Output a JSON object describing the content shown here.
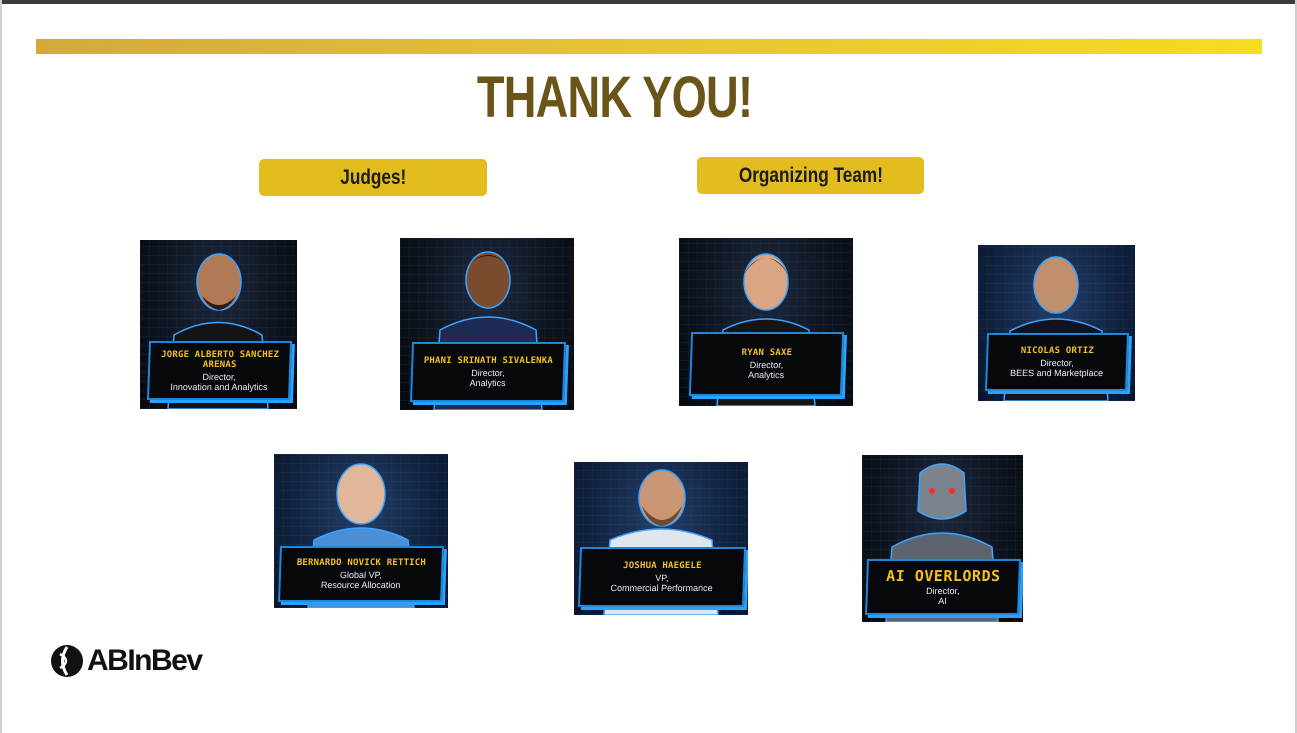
{
  "title": "THANK YOU!",
  "groups": {
    "judges": "Judges!",
    "organizing": "Organizing Team!"
  },
  "people": [
    {
      "name": "JORGE ALBERTO SANCHEZ ARENAS",
      "role_line1": "Director,",
      "role_line2": "Innovation and Analytics"
    },
    {
      "name": "PHANI SRINATH SIVALENKA",
      "role_line1": "Director,",
      "role_line2": "Analytics"
    },
    {
      "name": "RYAN SAXE",
      "role_line1": "Director,",
      "role_line2": "Analytics"
    },
    {
      "name": "NICOLAS ORTIZ",
      "role_line1": "Director,",
      "role_line2": "BEES and Marketplace"
    },
    {
      "name": "BERNARDO NOVICK RETTICH",
      "role_line1": "Global VP,",
      "role_line2": "Resource Allocation"
    },
    {
      "name": "JOSHUA HAEGELE",
      "role_line1": "VP,",
      "role_line2": "Commercial Performance"
    },
    {
      "name": "AI OVERLORDS",
      "role_line1": "Director,",
      "role_line2": "AI"
    }
  ],
  "logo": {
    "text": "ABInBev"
  },
  "colors": {
    "accent_gold": "#e3bd1d",
    "title_brown": "#6b5417",
    "plate_border": "#1e88d8",
    "name_yellow": "#f5c01a"
  }
}
